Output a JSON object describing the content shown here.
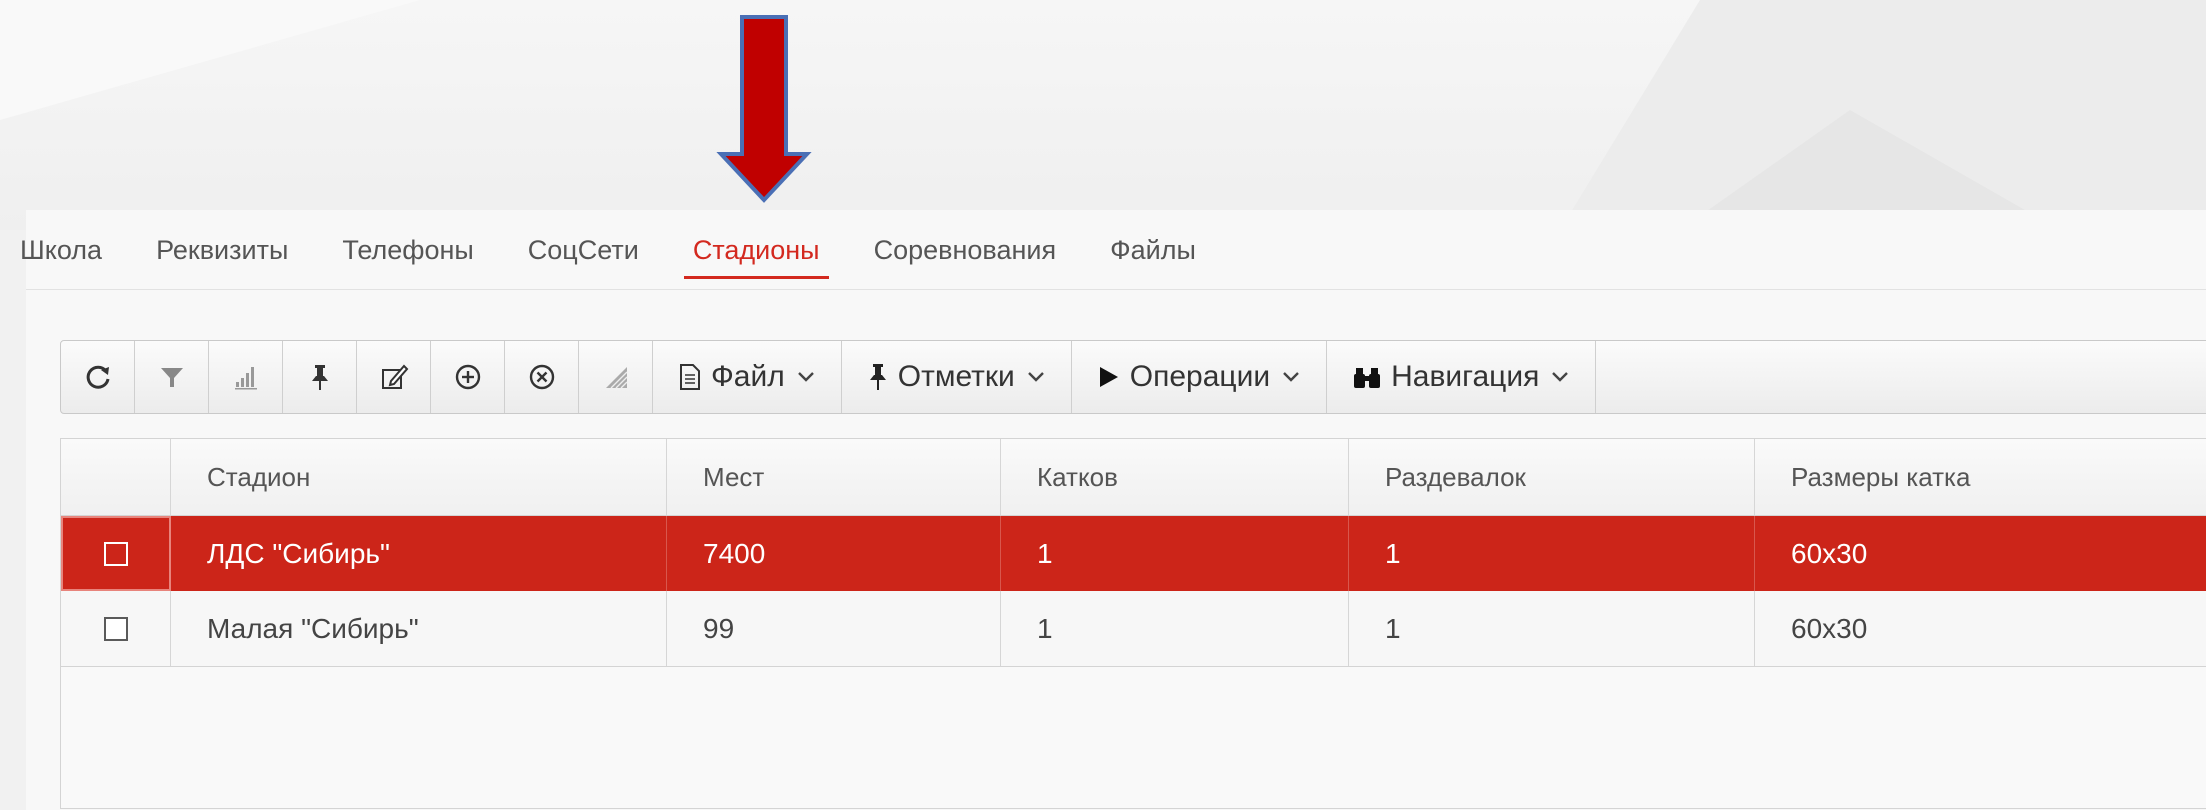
{
  "tabs": [
    {
      "label": "Школа",
      "active": false
    },
    {
      "label": "Реквизиты",
      "active": false
    },
    {
      "label": "Телефоны",
      "active": false
    },
    {
      "label": "СоцСети",
      "active": false
    },
    {
      "label": "Стадионы",
      "active": true
    },
    {
      "label": "Соревнования",
      "active": false
    },
    {
      "label": "Файлы",
      "active": false
    }
  ],
  "toolbar": {
    "icons": [
      "refresh-icon",
      "filter-icon",
      "bar-chart-icon",
      "pin-icon",
      "edit-icon",
      "add-circle-icon",
      "remove-circle-icon",
      "resize-icon"
    ],
    "file_label": "Файл",
    "marks_label": "Отметки",
    "operations_label": "Операции",
    "navigation_label": "Навигация"
  },
  "table": {
    "columns": [
      "Стадион",
      "Мест",
      "Катков",
      "Раздевалок",
      "Размеры катка"
    ],
    "rows": [
      {
        "selected": true,
        "cells": [
          "ЛДС \"Сибирь\"",
          "7400",
          "1",
          "1",
          "60x30"
        ]
      },
      {
        "selected": false,
        "cells": [
          "Малая \"Сибирь\"",
          "99",
          "1",
          "1",
          "60x30"
        ]
      }
    ]
  },
  "colors": {
    "accent": "#d3291f",
    "selected_row": "#cc2519",
    "arrow_fill": "#c00000",
    "arrow_stroke": "#4a6fb5"
  }
}
